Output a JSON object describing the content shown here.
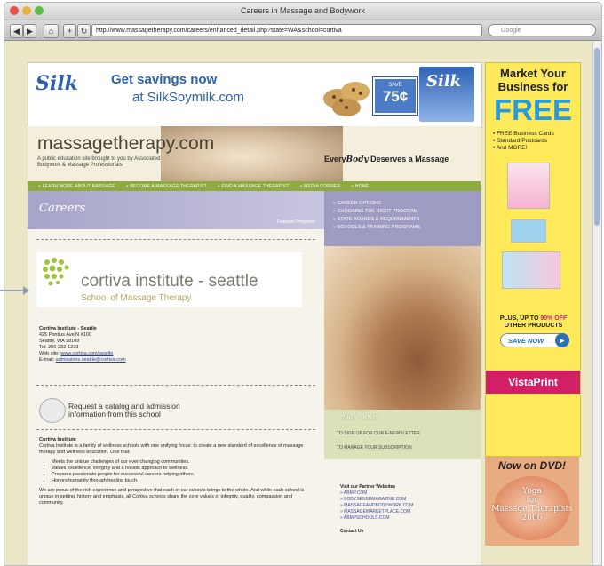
{
  "window": {
    "title": "Careers in Massage and Bodywork",
    "url": "http://www.massagetherapy.com/careers/enhanced_detail.php?state=WA&school=cortiva",
    "search_placeholder": "Google"
  },
  "banner_ad": {
    "brand": "Silk",
    "line1": "Get savings now",
    "line2": "at SilkSoymilk.com",
    "coupon_save": "SAVE",
    "coupon_amount": "75¢",
    "carton_label": "Silk"
  },
  "site": {
    "name": "massagetherapy.com",
    "subtitle": "A public education site brought to you by Associated Bodywork & Massage Professionals",
    "tagline_pre": "Every",
    "tagline_emph": "Body",
    "tagline_post": " Deserves a Massage"
  },
  "nav": {
    "items": [
      "» LEARN MORE ABOUT MASSAGE",
      "» BECOME A MASSAGE THERAPIST",
      "» FIND A MASSAGE THERAPIST",
      "» MEDIA CORNER",
      "» HOME"
    ]
  },
  "careers": {
    "title": "Careers",
    "subtitle": "Featured Programs"
  },
  "school": {
    "logo_name": "cortiva institute",
    "logo_city": " - seattle",
    "logo_school": "School of Massage Therapy",
    "contact_name": "Cortiva Institute - Seattle",
    "street": "425 Pontius Ave N #100",
    "city": "Seattle, WA 98109",
    "tel": "Tel: 206-282-1233",
    "web_label": "Web site:",
    "web": "www.cortiva.com/seattle",
    "email_label": "E-mail:",
    "email": "admissions.seattle@cortiva.com",
    "request": "Request a catalog and admission information from this school"
  },
  "description": {
    "heading": "Cortiva Institute",
    "intro": "Cortiva Institute is a family of wellness schools with one unifying focus: to create a new standard of excellence of massage therapy and wellness education. One that:",
    "bullets": [
      "Meets the unique challenges of our ever changing communities.",
      "Values excellence, integrity and a holistic approach to wellness.",
      "Prepares passionate people for successful careers helping others.",
      "Honors humanity through healing touch."
    ],
    "closing": "We are proud of the rich experience and perspective that each of our schools brings to the whole. And while each school is unique in setting, history and emphasis, all Cortiva schools share the core values of integrity, quality, compassion and community."
  },
  "side_menu": {
    "items": [
      "» CAREER OPTIONS",
      "» CHOOSING THE RIGHT PROGRAM",
      "» STATE BOARDS & REQUIREMENTS",
      "» SCHOOLS & TRAINING PROGRAMS"
    ]
  },
  "newsletter": {
    "title": "click here",
    "sign_up": "TO SIGN UP FOR OUR E-NEWSLETTER",
    "manage": "TO MANAGE YOUR SUBSCRIPTION"
  },
  "partners": {
    "heading": "Visit our Partner Websites",
    "links": [
      "» ABMP.COM",
      "» BODYSENSEMAGAZINE.COM",
      "» MASSAGEANDBODYWORK.COM",
      "» MASSAGEMARKETPLACE.COM",
      "» ABMPSCHOOLS.COM"
    ],
    "contact": "Contact Us"
  },
  "side_ad": {
    "title": "Market Your Business for",
    "free": "FREE",
    "list": [
      "• FREE Business Cards",
      "• Standard Postcards",
      "• And MORE!"
    ],
    "plus_pre": "PLUS, UP TO ",
    "plus_pct": "90% OFF",
    "plus_post": "OTHER PRODUCTS",
    "save_now": "SAVE NOW",
    "brand": "VistaPrint"
  },
  "dvd_ad": {
    "title": "Now on DVD!",
    "line1": "Yoga",
    "line2": "for",
    "line3": "Massage Therapists",
    "line4": "2006"
  }
}
